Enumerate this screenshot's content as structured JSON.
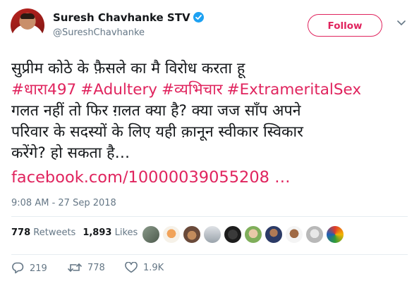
{
  "user": {
    "display_name": "Suresh Chavhanke STV",
    "handle": "@SureshChavhanke",
    "verified_icon": "verified-badge-icon"
  },
  "follow_button": {
    "label": "Follow"
  },
  "menu_icon": "chevron-down-icon",
  "tweet": {
    "line1": "सुप्रीम कोठे के फ़ैसले का मै विरोध करता हू",
    "hashtags": [
      "#धारा497",
      "#Adultery",
      "#व्यभिचार",
      "#ExtrameritalSex"
    ],
    "line3": "गलत नहीं तो फिर ग़लत क्या है? क्या जज साँप अपने",
    "line4": "परिवार के सदस्यों के लिए यही क़ानून स्वीकार स्विकार",
    "line5": "करेंगे? हो सकता है…",
    "link": "facebook.com/10000039055208 …"
  },
  "timestamp": "9:08 AM - 27 Sep 2018",
  "stats": {
    "retweets_count": "778",
    "retweets_label": "Retweets",
    "likes_count": "1,893",
    "likes_label": "Likes"
  },
  "actions": {
    "reply_count": "219",
    "retweet_count": "778",
    "like_count": "1.9K"
  },
  "colors": {
    "accent": "#e0245e",
    "verified": "#1da1f2",
    "muted": "#657786",
    "divider": "#e6ecf0"
  }
}
